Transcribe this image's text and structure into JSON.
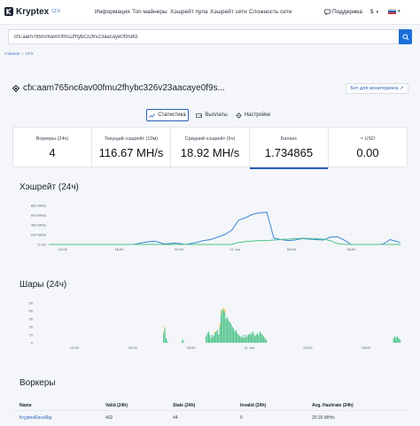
{
  "header": {
    "brand": "Kryptex",
    "brand_sub": "CFX",
    "nav": [
      "Информация",
      "Топ майнеры",
      "Хэшрейт пула",
      "Хэшрейт сети",
      "Сложность сети"
    ],
    "support": "Поддержка",
    "currency": "$",
    "colors": {
      "accent": "#1a6ed8",
      "brand_icon": "#2a5fb8"
    }
  },
  "search": {
    "value": "cfx:aam765nc6av00fmu2fhybc326v23aacaye0f9s8tz",
    "placeholder": ""
  },
  "breadcrumbs": [
    "Главная",
    "CFX"
  ],
  "account": {
    "address": "cfx:aam765nc6av00fmu2fhybc326v23aacaye0f9s...",
    "bot_button": "Бот для мониторинга ↗"
  },
  "tabs": {
    "stats": "Статистика",
    "payouts": "Выплаты",
    "settings": "Настройки"
  },
  "stats": [
    {
      "label": "Воркеры (24ч)",
      "value": "4"
    },
    {
      "label": "Текущий хэшрейт (10м)",
      "value": "116.67 MH/s"
    },
    {
      "label": "Средний хэшрейт (6ч)",
      "value": "18.92 MH/s"
    },
    {
      "label": "Баланс",
      "value": "1.734865"
    },
    {
      "label": "≈ USD",
      "value": "0.00"
    }
  ],
  "hashrate_section": {
    "title": "Хэшрейт (24ч)"
  },
  "shares_section": {
    "title": "Шары (24ч)"
  },
  "workers_section": {
    "title": "Воркеры",
    "headers": [
      "Name",
      "Valid (24h)",
      "Stale (24h)",
      "Invalid (24h)",
      "Avg. Hashrate (24h)"
    ],
    "rows": [
      {
        "name": "KryptexRavoRig",
        "valid": "402",
        "stale": "44",
        "invalid": "0",
        "hashrate": "20.93 MH/s"
      }
    ]
  },
  "chart_data": [
    {
      "type": "line",
      "title": "Хэшрейт (24ч)",
      "y_ticks": [
        "0 H/s",
        "200 MH/s",
        "400 MH/s",
        "600 MH/s",
        "800 MH/s"
      ],
      "ylim": [
        0,
        800
      ],
      "x_ticks": [
        "12:00",
        "16:00",
        "20:00",
        "11 Jun",
        "04:00",
        "08:00"
      ],
      "grid": true,
      "colors": {
        "current": "#3a86d6",
        "average": "#4cc38a"
      },
      "x": [
        0,
        6,
        12,
        18,
        24,
        27,
        30,
        33,
        36,
        39,
        42,
        44,
        46,
        48,
        50,
        52,
        54,
        56,
        58,
        60,
        62,
        64,
        66,
        68,
        70,
        72,
        74,
        76,
        78,
        80,
        82,
        84,
        86,
        88,
        90,
        92,
        94,
        95,
        96,
        97,
        98,
        99,
        100
      ],
      "series": [
        {
          "values": [
            0,
            0,
            0,
            0,
            0,
            40,
            70,
            10,
            30,
            0,
            40,
            80,
            100,
            150,
            200,
            290,
            500,
            550,
            620,
            650,
            660,
            130,
            100,
            80,
            90,
            120,
            110,
            100,
            90,
            150,
            160,
            90,
            0,
            0,
            0,
            0,
            0,
            10,
            50,
            100,
            80,
            60,
            40
          ]
        },
        {
          "values": [
            0,
            0,
            0,
            0,
            0,
            0,
            0,
            0,
            0,
            0,
            0,
            0,
            0,
            0,
            0,
            0,
            40,
            60,
            70,
            80,
            80,
            90,
            100,
            110,
            120,
            125,
            125,
            120,
            110,
            80,
            20,
            0,
            0,
            0,
            0,
            0,
            0,
            0,
            0,
            0,
            0,
            0,
            0
          ]
        }
      ]
    },
    {
      "type": "bar",
      "title": "Шары (24ч)",
      "y_ticks": [
        "0",
        "10",
        "20",
        "30",
        "40",
        "50"
      ],
      "ylim": [
        0,
        50
      ],
      "x_ticks": [
        "12:00",
        "16:00",
        "20:00",
        "11 Jun",
        "04:00",
        "08:00"
      ],
      "grid": true,
      "colors": {
        "valid": "#4cc38a",
        "stale": "#e8c84a"
      },
      "series": [
        {
          "name": "valid",
          "values": [
            0,
            0,
            0,
            0,
            0,
            0,
            0,
            0,
            0,
            0,
            0,
            0,
            0,
            0,
            0,
            0,
            0,
            0,
            0,
            0,
            0,
            0,
            0,
            0,
            0,
            0,
            0,
            0,
            0,
            0,
            0,
            0,
            0,
            0,
            0,
            0,
            0,
            0,
            0,
            0,
            0,
            0,
            0,
            0,
            0,
            0,
            0,
            0,
            0,
            0,
            0,
            0,
            0,
            0,
            0,
            0,
            0,
            0,
            0,
            0,
            0,
            0,
            0,
            0,
            0,
            0,
            0,
            0,
            0,
            0,
            0,
            0,
            0,
            0,
            0,
            0,
            0,
            0,
            0,
            0,
            0,
            0,
            0,
            0,
            0,
            0,
            0,
            0,
            0,
            0,
            0,
            0,
            0,
            0,
            0,
            0,
            0,
            0,
            0,
            0,
            0,
            0,
            12,
            18,
            6,
            2,
            0,
            0,
            0,
            0,
            0,
            0,
            0,
            0,
            0,
            0,
            0,
            4,
            2,
            0,
            0,
            0,
            0,
            0,
            0,
            0,
            0,
            0,
            0,
            0,
            0,
            0,
            0,
            0,
            0,
            0,
            8,
            12,
            14,
            10,
            6,
            10,
            8,
            12,
            14,
            16,
            10,
            20,
            36,
            42,
            40,
            38,
            30,
            32,
            28,
            26,
            24,
            20,
            18,
            14,
            16,
            12,
            10,
            8,
            8,
            6,
            10,
            6,
            10,
            8,
            10,
            12,
            10,
            14,
            12,
            8,
            10,
            12,
            10,
            14,
            12,
            10,
            8,
            6,
            4,
            0,
            0,
            0,
            0,
            0,
            0,
            0,
            0,
            0,
            0,
            0,
            0,
            0,
            0,
            0,
            0,
            0,
            0,
            0,
            0,
            0,
            0,
            0,
            0,
            0,
            0,
            0,
            0,
            0,
            0,
            0,
            0,
            0,
            0,
            0,
            0,
            0,
            0,
            0,
            0,
            0,
            0,
            0,
            0,
            0,
            0,
            0,
            0,
            0,
            0,
            0,
            0,
            0,
            0,
            0,
            0,
            0,
            0,
            0,
            0,
            0,
            0,
            0,
            0,
            0,
            0,
            0,
            0,
            0,
            0,
            0,
            0,
            0,
            0,
            0,
            0,
            0,
            0,
            0,
            0,
            0,
            0,
            0,
            0,
            0,
            0,
            0,
            0,
            0,
            0,
            0,
            0,
            0,
            0,
            0,
            0,
            0,
            0,
            0,
            0,
            0,
            6,
            8,
            6,
            8,
            6,
            4
          ]
        },
        {
          "name": "stale",
          "values": [
            0,
            0,
            0,
            0,
            0,
            0,
            0,
            0,
            0,
            0,
            0,
            0,
            0,
            0,
            0,
            0,
            0,
            0,
            0,
            0,
            0,
            0,
            0,
            0,
            0,
            0,
            0,
            0,
            0,
            0,
            0,
            0,
            0,
            0,
            0,
            0,
            0,
            0,
            0,
            0,
            0,
            0,
            0,
            0,
            0,
            0,
            0,
            0,
            0,
            0,
            0,
            0,
            0,
            0,
            0,
            0,
            0,
            0,
            0,
            0,
            0,
            0,
            0,
            0,
            0,
            0,
            0,
            0,
            0,
            0,
            0,
            0,
            0,
            0,
            0,
            0,
            0,
            0,
            0,
            0,
            0,
            0,
            0,
            0,
            0,
            0,
            0,
            0,
            0,
            0,
            0,
            0,
            0,
            0,
            0,
            0,
            0,
            0,
            0,
            0,
            0,
            0,
            2,
            2,
            0,
            0,
            0,
            0,
            0,
            0,
            0,
            0,
            0,
            0,
            0,
            0,
            0,
            0,
            0,
            0,
            0,
            0,
            0,
            0,
            0,
            0,
            0,
            0,
            0,
            0,
            0,
            0,
            0,
            0,
            0,
            0,
            0,
            0,
            0,
            0,
            0,
            0,
            0,
            2,
            0,
            0,
            0,
            4,
            4,
            0,
            4,
            4,
            0,
            0,
            0,
            0,
            0,
            0,
            0,
            0,
            0,
            0,
            0,
            0,
            0,
            0,
            0,
            0,
            0,
            0,
            0,
            0,
            0,
            0,
            0,
            0,
            0,
            0,
            0,
            0,
            0,
            0,
            0,
            0,
            0,
            0,
            0,
            0,
            0,
            0,
            0,
            0,
            0,
            0,
            0,
            0,
            0,
            0,
            0,
            0,
            0,
            0,
            0,
            0,
            0,
            0,
            0,
            0,
            0,
            0,
            0,
            0,
            0,
            0,
            0,
            0,
            0,
            0,
            0,
            0,
            0,
            0,
            0,
            0,
            0,
            0,
            0,
            0,
            0,
            0,
            0,
            0,
            0,
            0,
            0,
            0,
            0,
            0,
            0,
            0,
            0,
            0,
            0,
            0,
            0,
            0,
            0,
            0,
            0,
            0,
            0,
            0,
            0,
            0,
            0,
            0,
            0,
            0,
            0,
            0,
            0,
            0,
            0,
            0,
            0,
            0,
            0,
            0,
            0,
            0,
            0,
            0,
            0,
            0,
            0,
            0,
            0,
            0,
            0,
            0,
            0,
            0,
            0,
            0,
            0,
            0,
            0,
            0,
            0,
            0
          ]
        }
      ]
    }
  ]
}
